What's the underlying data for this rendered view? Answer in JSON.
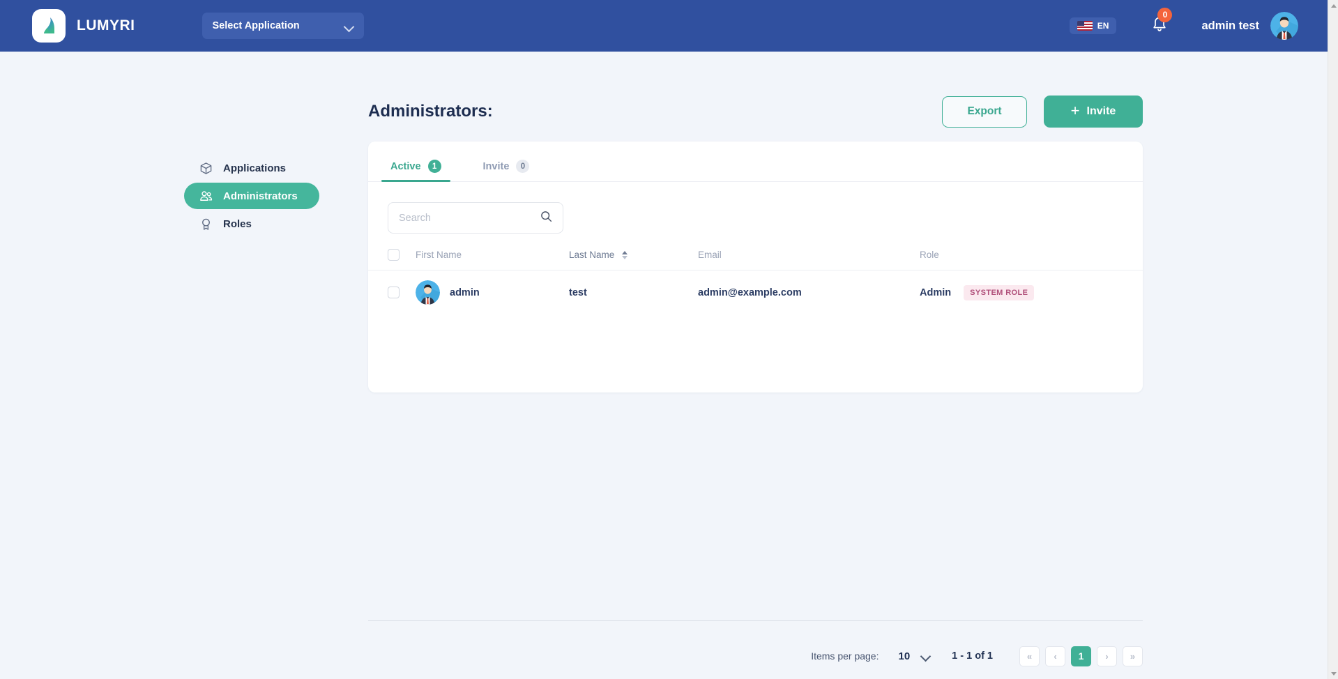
{
  "header": {
    "brand_name": "LUMYRI",
    "logo_icon": "lumyri-leaf-logo",
    "app_select_label": "Select Application",
    "app_select_icon": "chevron-down-icon",
    "language_code": "EN",
    "language_flag_icon": "us-flag-icon",
    "notification_icon": "bell-icon",
    "notification_count": "0",
    "user_name": "admin test",
    "user_avatar_icon": "user-avatar"
  },
  "sidebar": {
    "items": [
      {
        "label": "Applications",
        "icon": "box-icon",
        "active": false
      },
      {
        "label": "Administrators",
        "icon": "users-icon",
        "active": true
      },
      {
        "label": "Roles",
        "icon": "award-icon",
        "active": false
      }
    ]
  },
  "page": {
    "title": "Administrators:",
    "export_label": "Export",
    "invite_label": "Invite",
    "invite_icon": "plus-icon"
  },
  "tabs": [
    {
      "label": "Active",
      "badge": "1",
      "active": true
    },
    {
      "label": "Invite",
      "badge": "0",
      "active": false
    }
  ],
  "search": {
    "value": "",
    "placeholder": "Search",
    "icon": "search-icon"
  },
  "table": {
    "columns": [
      {
        "label": "First Name",
        "sortable": false
      },
      {
        "label": "Last Name",
        "sortable": true
      },
      {
        "label": "Email",
        "sortable": false
      },
      {
        "label": "Role",
        "sortable": false
      }
    ],
    "rows": [
      {
        "first_name": "admin",
        "last_name": "test",
        "email": "admin@example.com",
        "role": "Admin",
        "role_badge": "SYSTEM ROLE",
        "avatar_icon": "user-avatar"
      }
    ]
  },
  "pagination": {
    "items_per_page_label": "Items per page:",
    "items_per_page_value": "10",
    "items_per_page_icon": "chevron-down-icon",
    "range_label": "1 - 1 of 1",
    "first_label": "«",
    "prev_label": "‹",
    "current_page": "1",
    "next_label": "›",
    "last_label": "»"
  },
  "colors": {
    "header_bg": "#30509f",
    "accent_green": "#40b096",
    "badge_orange": "#f4643c",
    "system_role_bg": "#fbe9ef",
    "system_role_text": "#b04f7a",
    "page_bg": "#f2f5fa"
  }
}
